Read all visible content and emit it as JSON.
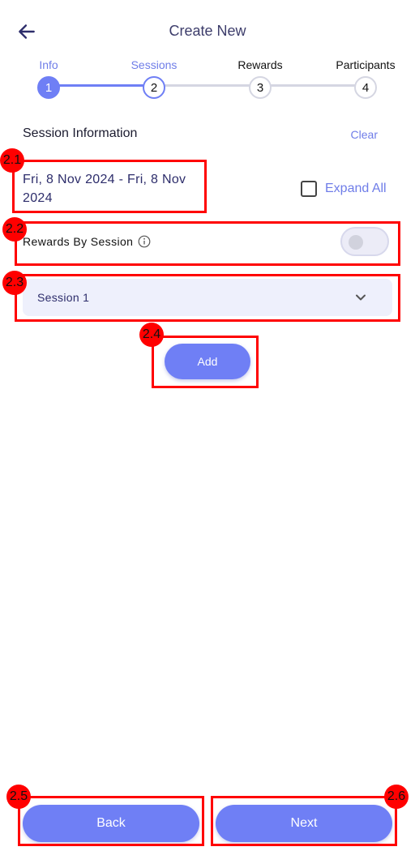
{
  "header": {
    "title": "Create New"
  },
  "stepper": {
    "steps": [
      {
        "label": "Info",
        "number": "1"
      },
      {
        "label": "Sessions",
        "number": "2"
      },
      {
        "label": "Rewards",
        "number": "3"
      },
      {
        "label": "Participants",
        "number": "4"
      }
    ]
  },
  "section": {
    "title": "Session Information",
    "clear_label": "Clear"
  },
  "date_range": "Fri, 8 Nov 2024 - Fri, 8 Nov 2024",
  "expand_all_label": "Expand All",
  "rewards": {
    "label": "Rewards By Session",
    "toggle_on": false
  },
  "session": {
    "label": "Session 1"
  },
  "add_label": "Add",
  "footer": {
    "back_label": "Back",
    "next_label": "Next"
  },
  "annotations": [
    "2.1",
    "2.2",
    "2.3",
    "2.4",
    "2.5",
    "2.6"
  ],
  "colors": {
    "accent": "#6f7ff5",
    "annotation": "#ff0000"
  }
}
